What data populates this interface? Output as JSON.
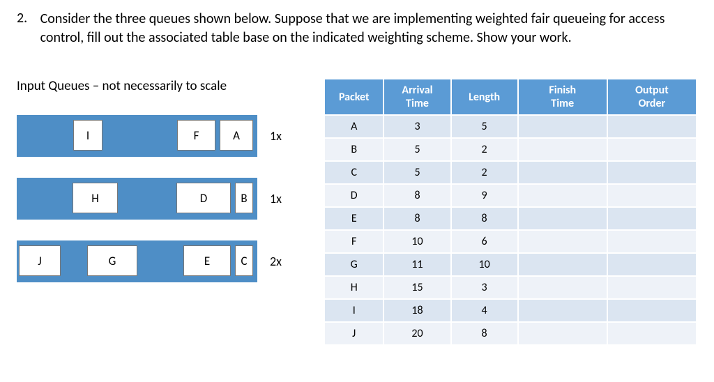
{
  "question": {
    "number": "2.",
    "text": "Consider the three queues shown below. Suppose that we are implementing weighted fair queueing for access control, fill out the associated table base on the indicated weighting scheme. Show your work."
  },
  "queues_caption": "Input Queues – not necessarily to scale",
  "queues": [
    {
      "weight": "1x",
      "packets": {
        "a": "A",
        "f": "F",
        "i": "I"
      }
    },
    {
      "weight": "1x",
      "packets": {
        "b": "B",
        "d": "D",
        "h": "H"
      }
    },
    {
      "weight": "2x",
      "packets": {
        "c": "C",
        "e": "E",
        "g": "G",
        "j": "J"
      }
    }
  ],
  "table": {
    "headers": {
      "packet": "Packet",
      "arrival1": "Arrival",
      "arrival2": "Time",
      "length": "Length",
      "finish1": "Finish",
      "finish2": "Time",
      "order1": "Output",
      "order2": "Order"
    },
    "rows": [
      {
        "packet": "A",
        "arrival": "3",
        "length": "5",
        "finish": "",
        "order": ""
      },
      {
        "packet": "B",
        "arrival": "5",
        "length": "2",
        "finish": "",
        "order": ""
      },
      {
        "packet": "C",
        "arrival": "5",
        "length": "2",
        "finish": "",
        "order": ""
      },
      {
        "packet": "D",
        "arrival": "8",
        "length": "9",
        "finish": "",
        "order": ""
      },
      {
        "packet": "E",
        "arrival": "8",
        "length": "8",
        "finish": "",
        "order": ""
      },
      {
        "packet": "F",
        "arrival": "10",
        "length": "6",
        "finish": "",
        "order": ""
      },
      {
        "packet": "G",
        "arrival": "11",
        "length": "10",
        "finish": "",
        "order": ""
      },
      {
        "packet": "H",
        "arrival": "15",
        "length": "3",
        "finish": "",
        "order": ""
      },
      {
        "packet": "I",
        "arrival": "18",
        "length": "4",
        "finish": "",
        "order": ""
      },
      {
        "packet": "J",
        "arrival": "20",
        "length": "8",
        "finish": "",
        "order": ""
      }
    ]
  }
}
